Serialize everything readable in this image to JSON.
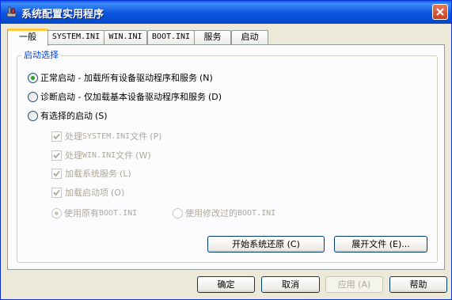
{
  "window": {
    "title": "系统配置实用程序"
  },
  "tabs": [
    "一般",
    "SYSTEM.INI",
    "WIN.INI",
    "BOOT.INI",
    "服务",
    "启动"
  ],
  "group": {
    "label": "启动选择"
  },
  "startup_options": [
    {
      "label": "正常启动 - 加载所有设备驱动程序和服务",
      "hotkey": "(N)",
      "selected": true
    },
    {
      "label": "诊断启动 - 仅加载基本设备驱动程序和服务",
      "hotkey": "(D)",
      "selected": false
    },
    {
      "label": "有选择的启动",
      "hotkey": "(S)",
      "selected": false
    }
  ],
  "selective": {
    "items": [
      {
        "prefix": "处理 ",
        "file": "SYSTEM.INI",
        "suffix": " 文件",
        "hotkey": "(P)",
        "checked": true
      },
      {
        "prefix": "处理 ",
        "file": "WIN.INI",
        "suffix": " 文件",
        "hotkey": "(W)",
        "checked": true
      },
      {
        "prefix": "加载系统服务",
        "file": "",
        "suffix": "",
        "hotkey": "(L)",
        "checked": true
      },
      {
        "prefix": "加载启动项",
        "file": "",
        "suffix": "",
        "hotkey": "(O)",
        "checked": true
      }
    ],
    "boot_original": {
      "prefix": "使用原有 ",
      "file": "BOOT.INI",
      "selected": true
    },
    "boot_modified": {
      "prefix": "使用修改过的 ",
      "file": "BOOT.INI",
      "selected": false
    }
  },
  "panel_buttons": {
    "restore": "开始系统还原 (C)",
    "expand": "展开文件 (E)..."
  },
  "footer_buttons": {
    "ok": "确定",
    "cancel": "取消",
    "apply": "应用 (A)",
    "help": "帮助"
  },
  "colors": {
    "titlebar": "#0A55DF",
    "group_label": "#0046D5",
    "tab_highlight": "#FFC83C",
    "radio_dot": "#21A121"
  }
}
